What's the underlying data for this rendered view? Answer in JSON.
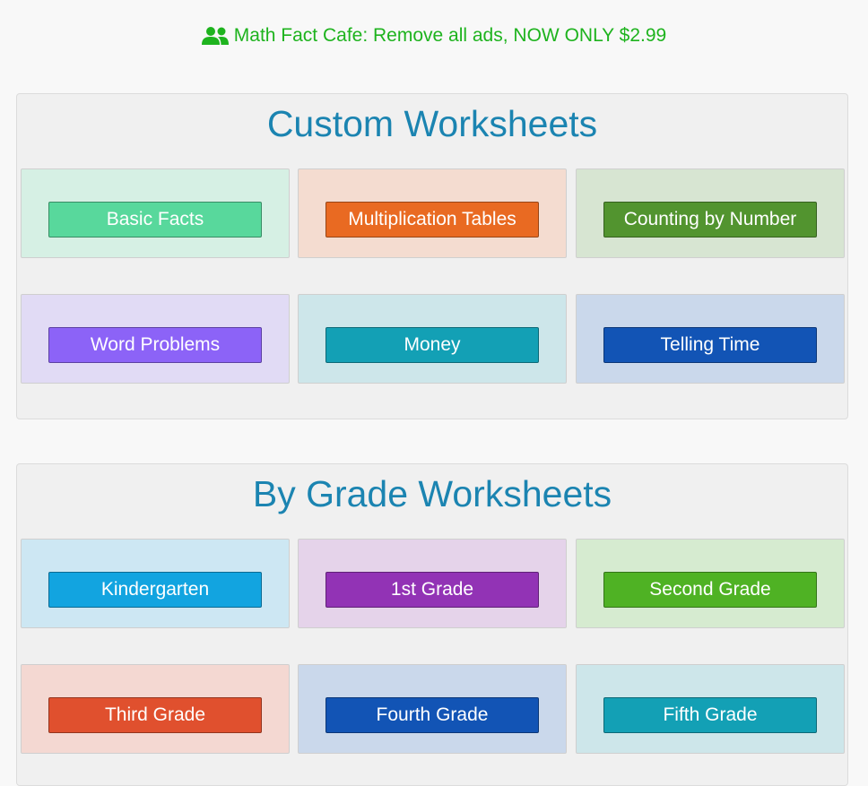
{
  "promo": {
    "icon": "users-icon",
    "text": "Math Fact Cafe: Remove all ads, NOW ONLY $2.99",
    "color": "#1eb31e"
  },
  "custom": {
    "title": "Custom Worksheets",
    "items": [
      {
        "label": "Basic Facts",
        "tile_bg": "#d6f0e4",
        "btn_bg": "#58d89c"
      },
      {
        "label": "Multiplication Tables",
        "tile_bg": "#f4dcd0",
        "btn_bg": "#e96a22"
      },
      {
        "label": "Counting by Number",
        "tile_bg": "#d7e5d2",
        "btn_bg": "#52942f"
      },
      {
        "label": "Word Problems",
        "tile_bg": "#e1dbf5",
        "btn_bg": "#8c63f7"
      },
      {
        "label": "Money",
        "tile_bg": "#cde6ea",
        "btn_bg": "#13a0b5"
      },
      {
        "label": "Telling Time",
        "tile_bg": "#cad8eb",
        "btn_bg": "#1254b5"
      }
    ]
  },
  "grade": {
    "title": "By Grade Worksheets",
    "items": [
      {
        "label": "Kindergarten",
        "tile_bg": "#cde7f3",
        "btn_bg": "#12a4e0"
      },
      {
        "label": "1st Grade",
        "tile_bg": "#e5d3ea",
        "btn_bg": "#9233b5"
      },
      {
        "label": "Second Grade",
        "tile_bg": "#d6ebd0",
        "btn_bg": "#4fb224"
      },
      {
        "label": "Third Grade",
        "tile_bg": "#f4d8d2",
        "btn_bg": "#e0502e"
      },
      {
        "label": "Fourth Grade",
        "tile_bg": "#cad8eb",
        "btn_bg": "#1254b5"
      },
      {
        "label": "Fifth Grade",
        "tile_bg": "#cde6ea",
        "btn_bg": "#13a0b5"
      }
    ]
  }
}
